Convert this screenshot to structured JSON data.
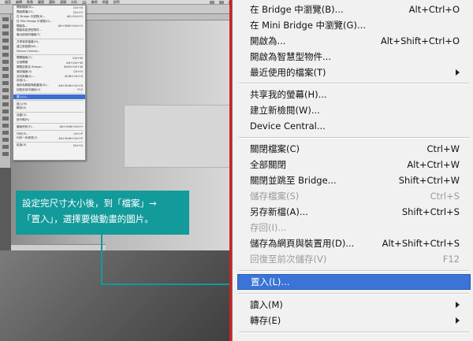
{
  "thumbnail": {
    "menubar": [
      "檔案",
      "編輯",
      "影像",
      "圖層",
      "選取",
      "濾鏡",
      "分析",
      "3D",
      "檢視",
      "視窗",
      "說明"
    ],
    "menu_items": [
      {
        "label": "開新檔案(N)...",
        "shortcut": "Ctrl+N"
      },
      {
        "label": "開啟舊檔(O)...",
        "shortcut": "Ctrl+O"
      },
      {
        "label": "在 Bridge 中瀏覽(B)...",
        "shortcut": "Alt+Ctrl+O"
      },
      {
        "label": "在 Mini Bridge 中瀏覽(G)...",
        "shortcut": ""
      },
      {
        "label": "開啟為...",
        "shortcut": "Alt+Shift+Ctrl+O"
      },
      {
        "label": "開啟為智慧型物件...",
        "shortcut": ""
      },
      {
        "label": "最近使用的檔案(T)",
        "shortcut": ""
      },
      {
        "sep": true
      },
      {
        "label": "共享我的螢幕(H)...",
        "shortcut": ""
      },
      {
        "label": "建立新檢閱(W)...",
        "shortcut": ""
      },
      {
        "label": "Device Central...",
        "shortcut": ""
      },
      {
        "sep": true
      },
      {
        "label": "關閉檔案(C)",
        "shortcut": "Ctrl+W"
      },
      {
        "label": "全部關閉",
        "shortcut": "Alt+Ctrl+W"
      },
      {
        "label": "關閉並跳至 Bridge...",
        "shortcut": "Shift+Ctrl+W"
      },
      {
        "label": "儲存檔案(S)",
        "shortcut": "Ctrl+S"
      },
      {
        "label": "另存新檔(A)...",
        "shortcut": "Shift+Ctrl+S"
      },
      {
        "label": "存回(I)...",
        "shortcut": ""
      },
      {
        "label": "儲存為網頁與裝置用(D)...",
        "shortcut": "Alt+Shift+Ctrl+S"
      },
      {
        "label": "回復至前次儲存(V)",
        "shortcut": "F12"
      },
      {
        "sep": true
      },
      {
        "label": "置入(L)...",
        "shortcut": "",
        "selected": true
      },
      {
        "sep": true
      },
      {
        "label": "讀入(M)",
        "shortcut": ""
      },
      {
        "label": "轉存(E)",
        "shortcut": ""
      },
      {
        "sep": true
      },
      {
        "label": "自動(U)",
        "shortcut": ""
      },
      {
        "label": "指令碼(R)",
        "shortcut": ""
      },
      {
        "sep": true
      },
      {
        "label": "檔案資訊(F)...",
        "shortcut": "Alt+Shift+Ctrl+I"
      },
      {
        "sep": true
      },
      {
        "label": "列印(P)...",
        "shortcut": "Ctrl+P"
      },
      {
        "label": "列印一份拷貝(Y)",
        "shortcut": "Alt+Shift+Ctrl+P"
      },
      {
        "sep": true
      },
      {
        "label": "結束(X)",
        "shortcut": "Ctrl+Q"
      }
    ]
  },
  "callout": {
    "line1": "設定完尺寸大小後，到「檔案」→",
    "line2": "「置入」，選擇要做動畫的圖片。",
    "color": "#139a9a"
  },
  "file_menu": {
    "items": [
      {
        "label": "在 Bridge 中瀏覽(B)...",
        "shortcut": "Alt+Ctrl+O"
      },
      {
        "label": "在 Mini Bridge 中瀏覽(G)...",
        "shortcut": ""
      },
      {
        "label": "開啟為...",
        "shortcut": "Alt+Shift+Ctrl+O"
      },
      {
        "label": "開啟為智慧型物件...",
        "shortcut": ""
      },
      {
        "label": "最近使用的檔案(T)",
        "shortcut": ""
      },
      {
        "label": "共享我的螢幕(H)...",
        "shortcut": ""
      },
      {
        "label": "建立新檢閱(W)...",
        "shortcut": ""
      },
      {
        "label": "Device Central...",
        "shortcut": ""
      },
      {
        "label": "關閉檔案(C)",
        "shortcut": "Ctrl+W"
      },
      {
        "label": "全部關閉",
        "shortcut": "Alt+Ctrl+W"
      },
      {
        "label": "關閉並跳至 Bridge...",
        "shortcut": "Shift+Ctrl+W"
      },
      {
        "label": "儲存檔案(S)",
        "shortcut": "Ctrl+S"
      },
      {
        "label": "另存新檔(A)...",
        "shortcut": "Shift+Ctrl+S"
      },
      {
        "label": "存回(I)...",
        "shortcut": ""
      },
      {
        "label": "儲存為網頁與裝置用(D)...",
        "shortcut": "Alt+Shift+Ctrl+S"
      },
      {
        "label": "回復至前次儲存(V)",
        "shortcut": "F12"
      },
      {
        "label": "置入(L)...",
        "shortcut": ""
      },
      {
        "label": "讀入(M)",
        "shortcut": ""
      },
      {
        "label": "轉存(E)",
        "shortcut": ""
      }
    ],
    "selected_color": "#3b74d6"
  }
}
